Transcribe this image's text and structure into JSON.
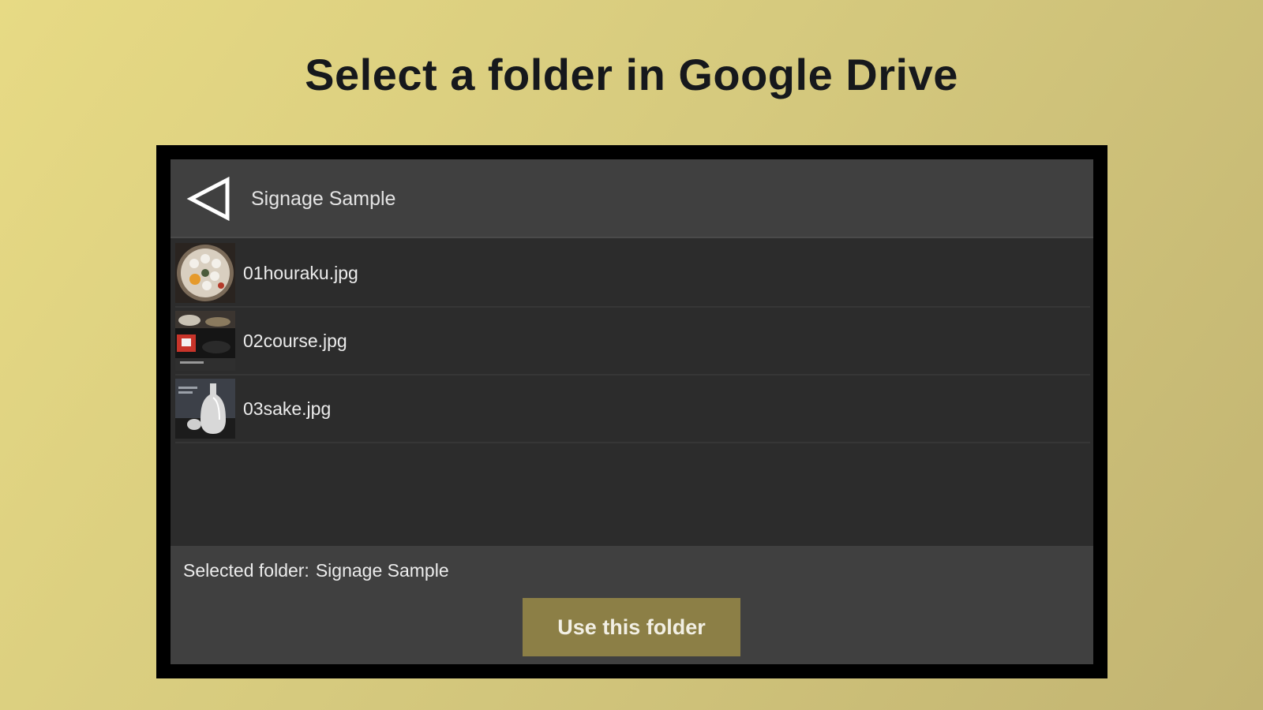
{
  "page": {
    "title": "Select a folder in Google Drive"
  },
  "browser": {
    "back_icon": "triangle-left-back-icon",
    "current_folder": "Signage Sample",
    "files": [
      {
        "name": "01houraku.jpg",
        "thumbnail": "sushi-platter-thumbnail"
      },
      {
        "name": "02course.jpg",
        "thumbnail": "course-meal-thumbnail"
      },
      {
        "name": "03sake.jpg",
        "thumbnail": "sake-bottle-thumbnail"
      }
    ]
  },
  "footer": {
    "selected_label": "Selected folder:",
    "selected_value": "Signage Sample",
    "use_button_label": "Use this folder"
  },
  "colors": {
    "background_gradient": [
      "#e7da84",
      "#c2b472"
    ],
    "title_text": "#16181c",
    "frame": "#000000",
    "panel": "#404040",
    "list_background": "#2c2c2c",
    "button_background": "#8c7f46",
    "button_text": "#f2efe4"
  }
}
